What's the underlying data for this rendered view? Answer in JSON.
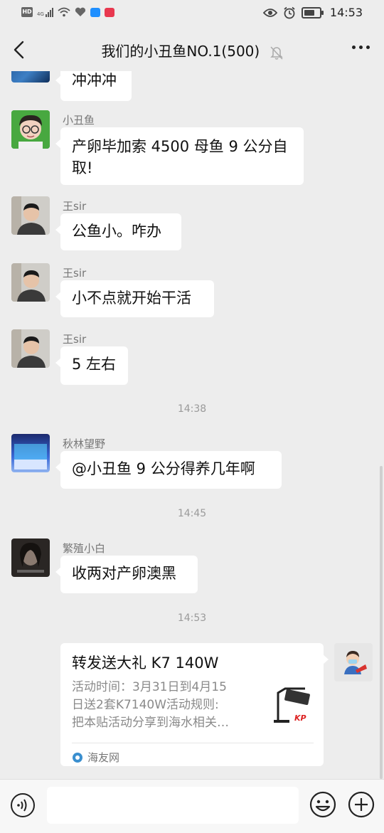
{
  "status_bar": {
    "hd_label": "HD",
    "network_label": "4G",
    "time": "14:53",
    "battery_level": 0.7,
    "icons": [
      "hd-icon",
      "signal-icon",
      "wifi-icon",
      "heart-icon",
      "app-icon",
      "notification-icon",
      "eye-icon",
      "alarm-icon",
      "battery-icon"
    ]
  },
  "header": {
    "title": "我们的小丑鱼NO.1(500)",
    "muted": true
  },
  "messages": [
    {
      "sender": "",
      "text": "冲冲冲"
    },
    {
      "sender": "小丑鱼",
      "text_line1": "产卵毕加索 4500 母鱼 9 公分自",
      "text_line2": "取!"
    },
    {
      "sender": "王sir",
      "text": "公鱼小。咋办"
    },
    {
      "sender": "王sir",
      "text": "小不点就开始干活"
    },
    {
      "sender": "王sir",
      "text": "5 左右"
    },
    {
      "timestamp": "14:38"
    },
    {
      "sender": "秋林望野",
      "text": "@小丑鱼  9 公分得养几年啊"
    },
    {
      "timestamp": "14:45"
    },
    {
      "sender": "繁殖小白",
      "text": "收两对产卵澳黑"
    },
    {
      "timestamp": "14:53"
    }
  ],
  "link_card": {
    "title": "转发送大礼 K7 140W",
    "desc_line1": "活动时间：3月31日到4月15",
    "desc_line2": "日送2套K7140W活动规则:",
    "desc_line3": "把本贴活动分享到海水相关…",
    "source": "海友网",
    "thumb_brand": "KP"
  },
  "input_bar": {
    "placeholder": ""
  },
  "colors": {
    "background": "#ededed",
    "bubble": "#ffffff",
    "input_bar": "#f7f7f7"
  }
}
